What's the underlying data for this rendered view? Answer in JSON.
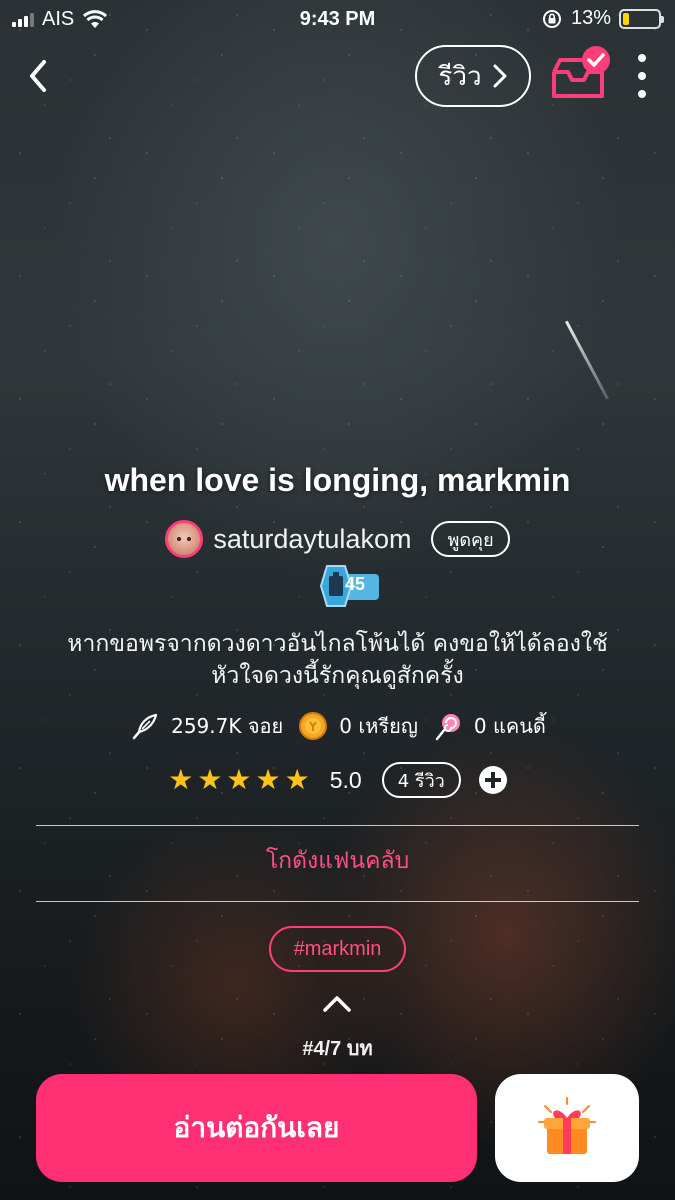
{
  "status_bar": {
    "carrier": "AIS",
    "time": "9:43 PM",
    "battery": "13%",
    "battery_level": 0.13
  },
  "nav": {
    "review_label": "รีวิว"
  },
  "story": {
    "title": "when love is longing, markmin",
    "author": "saturdaytulakom",
    "chat_label": "พูดคุย",
    "level": "45",
    "description_line1": "หากขอพรจากดวงดาวอันไกลโพ้นได้ คงขอให้ได้ลองใช้",
    "description_line2": "หัวใจดวงนี้รักคุณดูสักครั้ง"
  },
  "stats": {
    "reads": "259.7K จอย",
    "coins": "0 เหรียญ",
    "candy": "0 แคนดี้"
  },
  "rating": {
    "stars": 5,
    "value": "5.0",
    "reviews_label": "4 รีวิว"
  },
  "fanclub_label": "โกดังแฟนคลับ",
  "tag": "#markmin",
  "chapter": "#4/7 บท",
  "read_button": "อ่านต่อกันเลย",
  "colors": {
    "accent": "#ff2f73",
    "accent_text": "#ff4f84",
    "star": "#ffc21a",
    "battery": "#ffd400"
  }
}
